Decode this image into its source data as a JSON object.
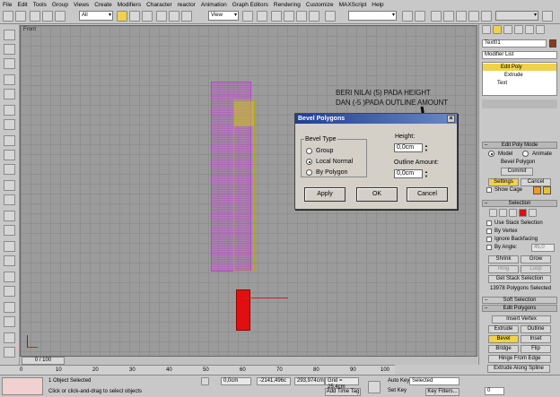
{
  "menu": [
    "File",
    "Edit",
    "Tools",
    "Group",
    "Views",
    "Create",
    "Modifiers",
    "Character",
    "reactor",
    "Animation",
    "Graph Editors",
    "Rendering",
    "Customize",
    "MAXScript",
    "Help"
  ],
  "toolbar": {
    "selection_filter": "All",
    "view_dropdown": "View"
  },
  "viewport": {
    "label": "Front"
  },
  "annotation": {
    "line1": "BERI NILAI (5) PADA HEIGHT",
    "line2": "DAN (-5 )PADA OUTLINE AMOUNT"
  },
  "dialog": {
    "title": "Bevel Polygons",
    "bevel_type_label": "Bevel Type",
    "options": [
      "Group",
      "Local Normal",
      "By Polygon"
    ],
    "selected_option": "Local Normal",
    "height_label": "Height:",
    "height_value": "0,0cm",
    "outline_label": "Outline Amount:",
    "outline_value": "0,0cm",
    "apply": "Apply",
    "ok": "OK",
    "cancel": "Cancel"
  },
  "panel": {
    "object_name": "Text01",
    "modifier_list": "Modifier List",
    "stack": [
      "Edit Poly",
      "Extrude",
      "Text"
    ],
    "edit_poly_mode": "Edit Poly Mode",
    "model": "Model",
    "animate": "Animate",
    "current_op": "Bevel Polygon",
    "commit": "Commit",
    "settings": "Settings",
    "cancel": "Cancel",
    "show_cage": "Show Cage",
    "selection": "Selection",
    "use_stack_selection": "Use Stack Selection",
    "by_vertex": "By Vertex",
    "ignore_backfacing": "Ignore Backfacing",
    "by_angle": "By Angle:",
    "by_angle_value": "45,0",
    "shrink": "Shrink",
    "grow": "Grow",
    "ring": "Ring",
    "loop": "Loop",
    "get_stack_selection": "Get Stack Selection",
    "selected_count": "13978 Polygons Selected",
    "soft_selection": "Soft Selection",
    "edit_polygons": "Edit Polygons",
    "insert_vertex": "Insert Vertex",
    "extrude": "Extrude",
    "outline": "Outline",
    "bevel": "Bevel",
    "inset": "Inset",
    "bridge": "Bridge",
    "flip": "Flip",
    "hinge_from_edge": "Hinge From Edge",
    "extrude_along_spline": "Extrude Along Spline"
  },
  "timeline": {
    "frame": "0 / 100",
    "ticks": [
      "0",
      "10",
      "20",
      "30",
      "40",
      "50",
      "60",
      "70",
      "80",
      "90",
      "100"
    ]
  },
  "status": {
    "objects_selected": "1 Object Selected",
    "prompt": "Click or click-and-drag to select objects",
    "x": "0,0cm",
    "y": "-2141,496c",
    "z": "293,974cm",
    "grid": "Grid = 25,4cm",
    "add_time_tag": "Add Time Tag",
    "auto_key": "Auto Key",
    "set_key": "Set Key",
    "key_mode": "Selected",
    "key_filters": "Key Filters...",
    "frame_field": "0"
  },
  "colors": {
    "accent_yellow": "#f0d24a",
    "object_magenta": "#c040d0",
    "object_red": "#e01010",
    "title_blue": "#1d3f92"
  }
}
